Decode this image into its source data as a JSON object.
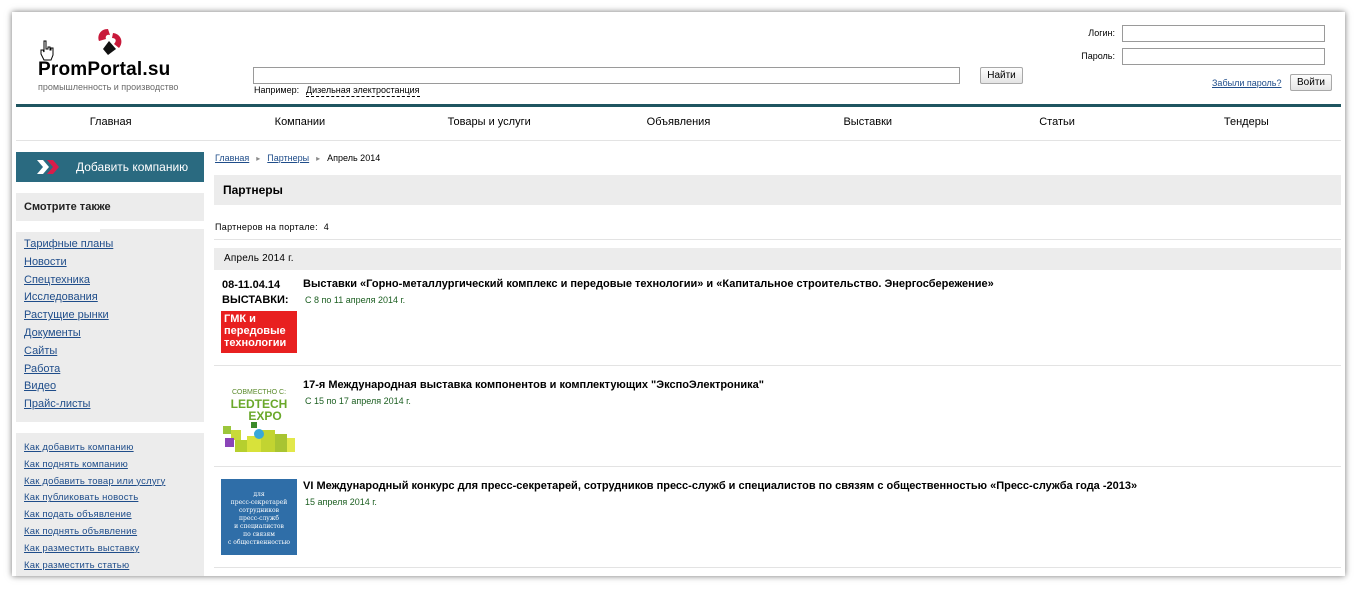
{
  "header": {
    "brand": "PromPortal.su",
    "tagline": "промышленность и производство",
    "search": {
      "value": "",
      "button": "Найти",
      "example_label": "Например:",
      "example_value": "Дизельная электростанция"
    },
    "login": {
      "login_label": "Логин:",
      "password_label": "Пароль:",
      "forgot": "Забыли пароль?",
      "button": "Войти"
    }
  },
  "nav": [
    "Главная",
    "Компании",
    "Товары и услуги",
    "Объявления",
    "Выставки",
    "Статьи",
    "Тендеры"
  ],
  "sidebar": {
    "add_company": "Добавить компанию",
    "see_also_title": "Смотрите также",
    "see_also": [
      "Тарифные планы",
      "Новости",
      "Спецтехника",
      "Исследования",
      "Растущие рынки",
      "Документы",
      "Сайты",
      "Работа",
      "Видео",
      "Прайс-листы"
    ],
    "howto": [
      "Как добавить компанию",
      "Как поднять компанию",
      "Как добавить товар или услугу",
      "Как публиковать новость",
      "Как подать объявление",
      "Как поднять объявление",
      "Как разместить выставку",
      "Как разместить статью"
    ]
  },
  "breadcrumb": [
    "Главная",
    "Партнеры",
    "Апрель 2014"
  ],
  "main": {
    "title": "Партнеры",
    "count_label": "Партнеров на портале:",
    "count_value": "4",
    "month": "Апрель 2014 г.",
    "items": [
      {
        "title": "Выставки «Горно-металлургический комплекс и передовые технологии» и «Капитальное строительство. Энергосбережение»",
        "date": "С 8 по 11 апреля 2014 г.",
        "thumb_text": [
          "08-11.04.14",
          "ВЫСТАВКИ:",
          "ГМК и",
          "передовые",
          "технологии"
        ]
      },
      {
        "title": "17-я Международная выставка компонентов и комплектующих \"ЭкспоЭлектроника\"",
        "date": "С 15 по 17 апреля 2014 г.",
        "thumb_text": [
          "СОВМЕСТНО С:",
          "LEDTECH",
          "EXPO"
        ]
      },
      {
        "title": "VI Международный конкурс для пресс-секретарей, сотрудников пресс-служб и специалистов по связям с общественностью «Пресс-служба года -2013»",
        "date": "15 апреля 2014 г.",
        "thumb_text": [
          "для",
          "пресс-секретарей",
          "сотрудников",
          "пресс-служб",
          "и специалистов",
          "по связям",
          "с общественностью"
        ]
      }
    ]
  },
  "colors": {
    "nav_line": "#1f5560",
    "add_company_bg": "#2a6a80",
    "link": "#1f4d8a",
    "date": "#1b5e20",
    "panel_bg": "#ececec"
  }
}
